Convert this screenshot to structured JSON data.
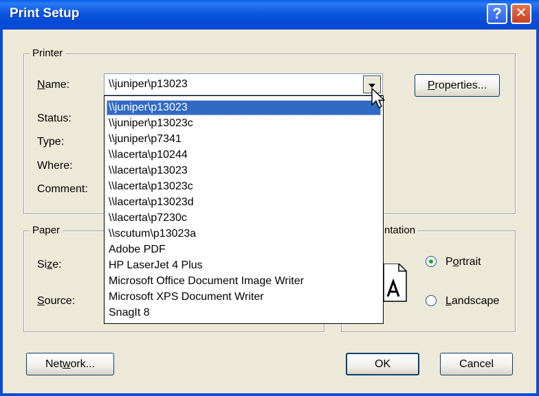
{
  "window": {
    "title": "Print Setup",
    "help_symbol": "?",
    "close_symbol": "✕"
  },
  "printer": {
    "group_label": "Printer",
    "name_label": "Name:",
    "status_label": "Status:",
    "type_label": "Type:",
    "where_label": "Where:",
    "comment_label": "Comment:",
    "selected": "\\\\juniper\\p13023",
    "properties_button": "Properties...",
    "dropdown_options": [
      "\\\\juniper\\p13023",
      "\\\\juniper\\p13023c",
      "\\\\juniper\\p7341",
      "\\\\lacerta\\p10244",
      "\\\\lacerta\\p13023",
      "\\\\lacerta\\p13023c",
      "\\\\lacerta\\p13023d",
      "\\\\lacerta\\p7230c",
      "\\\\scutum\\p13023a",
      "Adobe PDF",
      "HP LaserJet 4 Plus",
      "Microsoft Office Document Image Writer",
      "Microsoft XPS Document Writer",
      "SnagIt 8"
    ]
  },
  "paper": {
    "group_label": "Paper",
    "size_label": "Size:",
    "source_label": "Source:"
  },
  "orientation": {
    "group_label_visible": "ntation",
    "portrait_label": "Portrait",
    "landscape_label": "Landscape",
    "selected": "Portrait"
  },
  "buttons": {
    "network": "Network...",
    "ok": "OK",
    "cancel": "Cancel"
  },
  "colors": {
    "titlebar": "#0a4cd8",
    "selection": "#316ac5",
    "dialog_bg": "#ece9d8"
  }
}
